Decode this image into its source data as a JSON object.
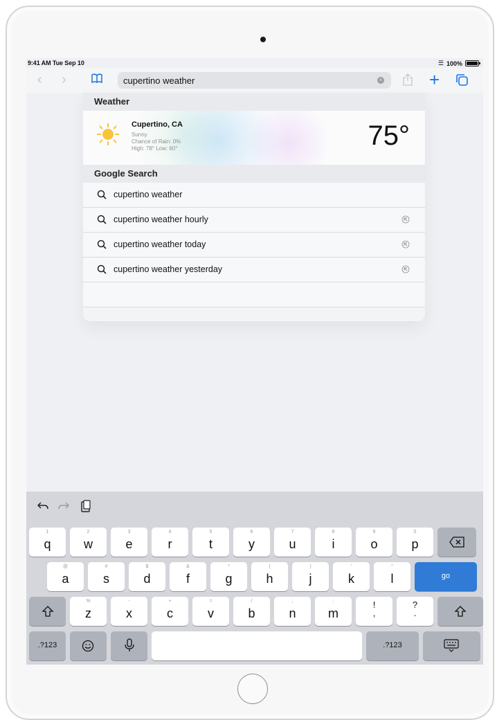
{
  "status": {
    "time": "9:41 AM  Tue Sep 10",
    "battery": "100%"
  },
  "toolbar": {
    "address": "cupertino weather"
  },
  "panel": {
    "weather_header": "Weather",
    "weather": {
      "city": "Cupertino, CA",
      "condition": "Sunny",
      "rain": "Chance of Rain: 0%",
      "highlow": "High: 78° Low: 60°",
      "temp": "75°"
    },
    "search_header": "Google Search",
    "suggestions": [
      {
        "text": "cupertino weather",
        "fill": false
      },
      {
        "text": "cupertino weather hourly",
        "fill": true
      },
      {
        "text": "cupertino weather today",
        "fill": true
      },
      {
        "text": "cupertino weather yesterday",
        "fill": true
      }
    ]
  },
  "keyboard": {
    "row1": [
      {
        "main": "q",
        "hint": "1"
      },
      {
        "main": "w",
        "hint": "2"
      },
      {
        "main": "e",
        "hint": "3"
      },
      {
        "main": "r",
        "hint": "4"
      },
      {
        "main": "t",
        "hint": "5"
      },
      {
        "main": "y",
        "hint": "6"
      },
      {
        "main": "u",
        "hint": "7"
      },
      {
        "main": "i",
        "hint": "8"
      },
      {
        "main": "o",
        "hint": "9"
      },
      {
        "main": "p",
        "hint": "0"
      }
    ],
    "row2": [
      {
        "main": "a",
        "hint": "@"
      },
      {
        "main": "s",
        "hint": "#"
      },
      {
        "main": "d",
        "hint": "$"
      },
      {
        "main": "f",
        "hint": "&"
      },
      {
        "main": "g",
        "hint": "*"
      },
      {
        "main": "h",
        "hint": "("
      },
      {
        "main": "j",
        "hint": ")"
      },
      {
        "main": "k",
        "hint": "'"
      },
      {
        "main": "l",
        "hint": "\""
      }
    ],
    "row3": [
      {
        "main": "z",
        "hint": "%"
      },
      {
        "main": "x",
        "hint": "-"
      },
      {
        "main": "c",
        "hint": "+"
      },
      {
        "main": "v",
        "hint": "="
      },
      {
        "main": "b",
        "hint": "/"
      },
      {
        "main": "n",
        "hint": ";"
      },
      {
        "main": "m",
        "hint": ":"
      },
      {
        "main": "!\n,",
        "hint": ""
      },
      {
        "main": "?\n.",
        "hint": ""
      }
    ],
    "go_label": "go",
    "numbers_label": ".?123"
  },
  "colors": {
    "accent": "#2f7bd6",
    "tint": "#1a73e8"
  }
}
